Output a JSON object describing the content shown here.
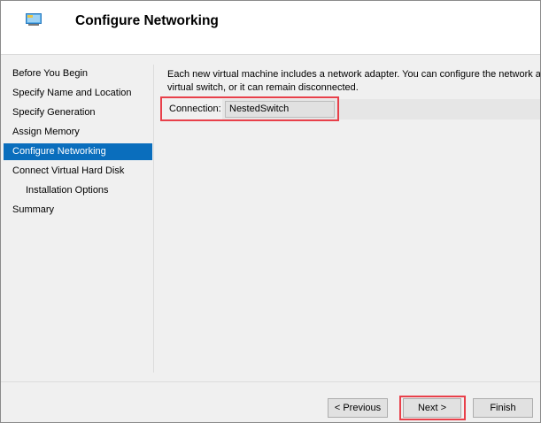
{
  "header": {
    "title": "Configure Networking",
    "icon": "network-adapter-icon"
  },
  "nav": {
    "items": [
      {
        "label": "Before You Begin",
        "active": false,
        "sub": false
      },
      {
        "label": "Specify Name and Location",
        "active": false,
        "sub": false
      },
      {
        "label": "Specify Generation",
        "active": false,
        "sub": false
      },
      {
        "label": "Assign Memory",
        "active": false,
        "sub": false
      },
      {
        "label": "Configure Networking",
        "active": true,
        "sub": false
      },
      {
        "label": "Connect Virtual Hard Disk",
        "active": false,
        "sub": false
      },
      {
        "label": "Installation Options",
        "active": false,
        "sub": true
      },
      {
        "label": "Summary",
        "active": false,
        "sub": false
      }
    ]
  },
  "content": {
    "description_line1": "Each new virtual machine includes a network adapter. You can configure the network ad",
    "description_line2": "virtual switch, or it can remain disconnected.",
    "connection_label": "Connection:",
    "connection_value": "NestedSwitch"
  },
  "buttons": {
    "previous": "< Previous",
    "next": "Next >",
    "finish": "Finish"
  },
  "colors": {
    "active_nav": "#0a6ebd",
    "highlight": "#e8404a"
  }
}
